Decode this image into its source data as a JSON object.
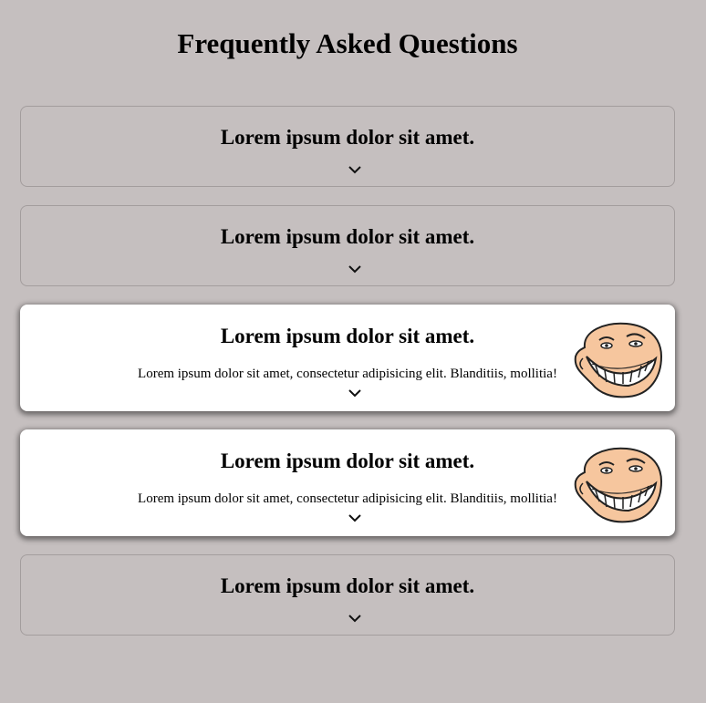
{
  "page": {
    "title": "Frequently Asked Questions"
  },
  "faq": {
    "items": [
      {
        "question": "Lorem ipsum dolor sit amet.",
        "answer": "",
        "expanded": false
      },
      {
        "question": "Lorem ipsum dolor sit amet.",
        "answer": "",
        "expanded": false
      },
      {
        "question": "Lorem ipsum dolor sit amet.",
        "answer": "Lorem ipsum dolor sit amet, consectetur adipisicing elit. Blanditiis, mollitia!",
        "expanded": true
      },
      {
        "question": "Lorem ipsum dolor sit amet.",
        "answer": "Lorem ipsum dolor sit amet, consectetur adipisicing elit. Blanditiis, mollitia!",
        "expanded": true
      },
      {
        "question": "Lorem ipsum dolor sit amet.",
        "answer": "",
        "expanded": false
      }
    ]
  },
  "colors": {
    "background": "#c5bfbf",
    "card_expanded": "#ffffff",
    "border": "#a39d9d"
  },
  "icons": {
    "toggle": "chevron-down-icon",
    "face": "troll-face-icon"
  }
}
